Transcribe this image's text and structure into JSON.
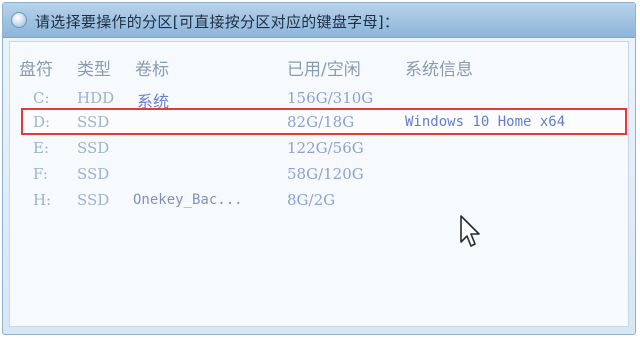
{
  "dialog": {
    "title": "请选择要操作的分区[可直接按分区对应的键盘字母]："
  },
  "table": {
    "headers": {
      "drive": "盘符",
      "type": "类型",
      "label": "卷标",
      "usage": "已用/空闲",
      "system": "系统信息"
    },
    "rows": [
      {
        "drive": "C:",
        "type": "HDD",
        "label": "系统",
        "usage": "156G/310G",
        "system": ""
      },
      {
        "drive": "D:",
        "type": "SSD",
        "label": "",
        "usage": "82G/18G",
        "system": "Windows 10 Home x64"
      },
      {
        "drive": "E:",
        "type": "SSD",
        "label": "",
        "usage": "122G/56G",
        "system": ""
      },
      {
        "drive": "F:",
        "type": "SSD",
        "label": "",
        "usage": "58G/120G",
        "system": ""
      },
      {
        "drive": "H:",
        "type": "SSD",
        "label": "Onekey_Bac...",
        "usage": "8G/2G",
        "system": ""
      }
    ],
    "selected_row": 1
  },
  "colors": {
    "selection_border": "#e8383a",
    "title_bar": "#9fc2e2"
  }
}
